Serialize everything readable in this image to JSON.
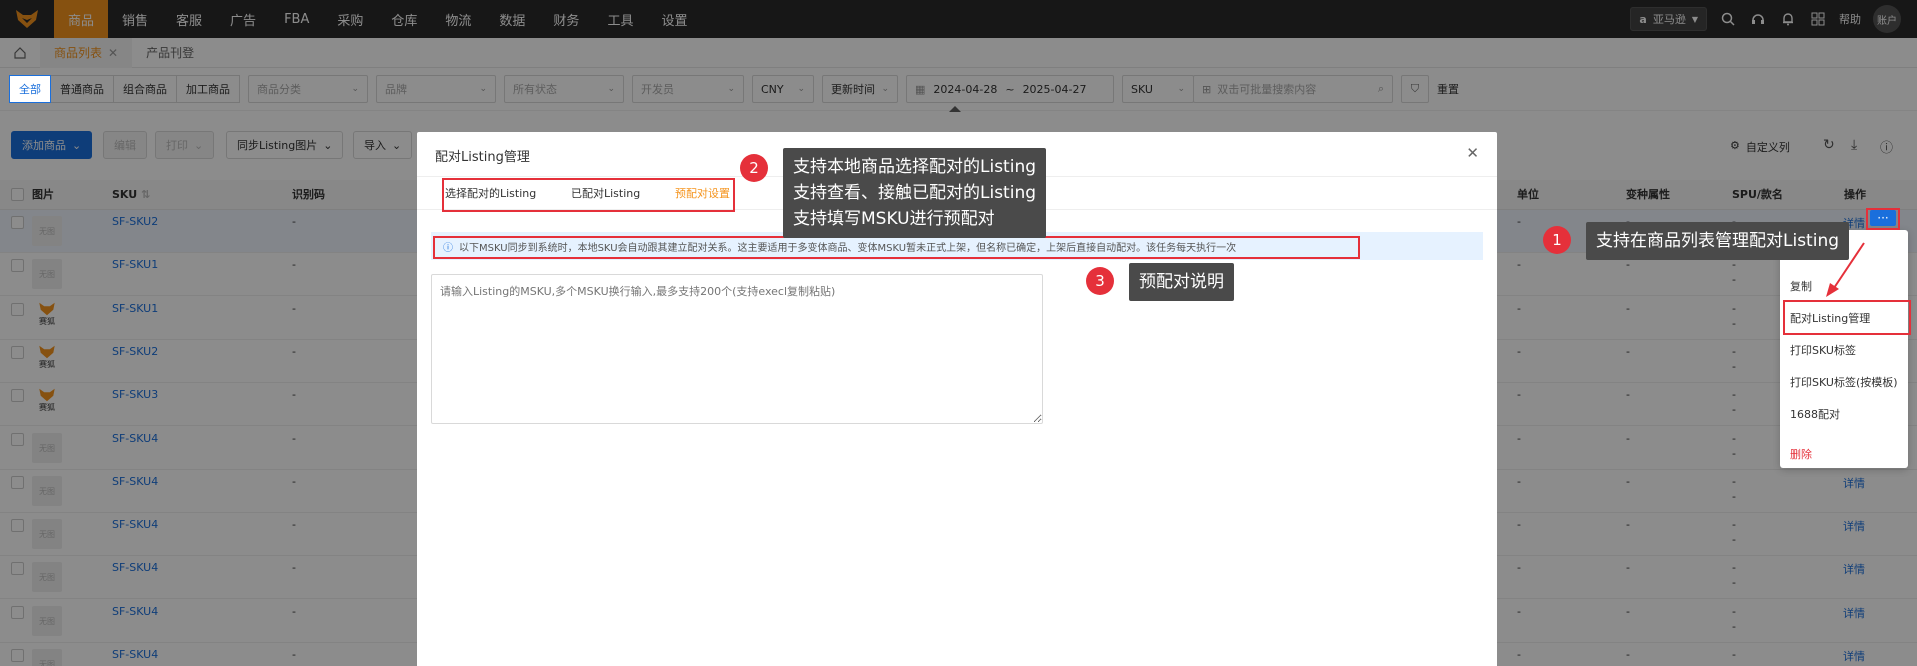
{
  "nav": {
    "items": [
      "商品",
      "销售",
      "客服",
      "广告",
      "FBA",
      "采购",
      "仓库",
      "物流",
      "数据",
      "财务",
      "工具",
      "设置"
    ],
    "active_index": 0,
    "platform": "亚马逊",
    "help": "帮助",
    "account": "账户"
  },
  "tabs": [
    {
      "label": "商品列表",
      "active": true,
      "closable": true
    },
    {
      "label": "产品刊登",
      "active": false,
      "closable": false
    }
  ],
  "filters": {
    "segments": [
      "全部",
      "普通商品",
      "组合商品",
      "加工商品"
    ],
    "category_placeholder": "商品分类",
    "brand_placeholder": "品牌",
    "status_placeholder": "所有状态",
    "developer_placeholder": "开发员",
    "currency": "CNY",
    "time_type": "更新时间",
    "date_from": "2024-04-28",
    "date_sep": "~",
    "date_to": "2025-04-27",
    "search_field": "SKU",
    "search_placeholder": "双击可批量搜索内容",
    "reset": "重置"
  },
  "toolbar": {
    "add": "添加商品",
    "edit": "编辑",
    "print": "打印",
    "sync": "同步Listing图片",
    "import": "导入",
    "custom_columns": "自定义列"
  },
  "table": {
    "headers": [
      "图片",
      "SKU",
      "识别码",
      "单位",
      "变种属性",
      "SPU/款名",
      "操作"
    ],
    "no_image": "无图",
    "fox_label": "赛狐",
    "rows": [
      {
        "sku": "SF-SKU2",
        "img": "none",
        "highlight": true
      },
      {
        "sku": "SF-SKU1",
        "img": "none"
      },
      {
        "sku": "SF-SKU1",
        "img": "fox"
      },
      {
        "sku": "SF-SKU2",
        "img": "fox"
      },
      {
        "sku": "SF-SKU3",
        "img": "fox"
      },
      {
        "sku": "SF-SKU4",
        "img": "none"
      },
      {
        "sku": "SF-SKU4",
        "img": "none"
      },
      {
        "sku": "SF-SKU4",
        "img": "none"
      },
      {
        "sku": "SF-SKU4",
        "img": "none"
      },
      {
        "sku": "SF-SKU4",
        "img": "none"
      },
      {
        "sku": "SF-SKU4",
        "img": "none"
      }
    ],
    "dash": "-",
    "detail": "详情",
    "more": "···"
  },
  "modal": {
    "title": "配对Listing管理",
    "tabs": [
      "选择配对的Listing",
      "已配对Listing",
      "预配对设置"
    ],
    "active_tab": 2,
    "info": "以下MSKU同步到系统时，本地SKU会自动跟其建立配对关系。这主要适用于多变体商品、变体MSKU暂未正式上架，但名称已确定，上架后直接自动配对。该任务每天执行一次",
    "textarea_placeholder": "请输入Listing的MSKU,多个MSKU换行输入,最多支持200个(支持execl复制粘贴)"
  },
  "menu": {
    "items": [
      "编辑",
      "复制",
      "配对Listing管理",
      "打印SKU标签",
      "打印SKU标签(按模板)",
      "1688配对",
      "删除"
    ]
  },
  "annotations": {
    "c1": {
      "num": "1",
      "text": "支持在商品列表管理配对Listing"
    },
    "c2": {
      "num": "2",
      "lines": [
        "支持本地商品选择配对的Listing",
        "支持查看、接触已配对的Listing",
        "支持填写MSKU进行预配对"
      ]
    },
    "c3": {
      "num": "3",
      "text": "预配对说明"
    }
  },
  "colors": {
    "brand": "#f5941e",
    "primary": "#1a6fdc",
    "annotation": "#e5303a"
  }
}
